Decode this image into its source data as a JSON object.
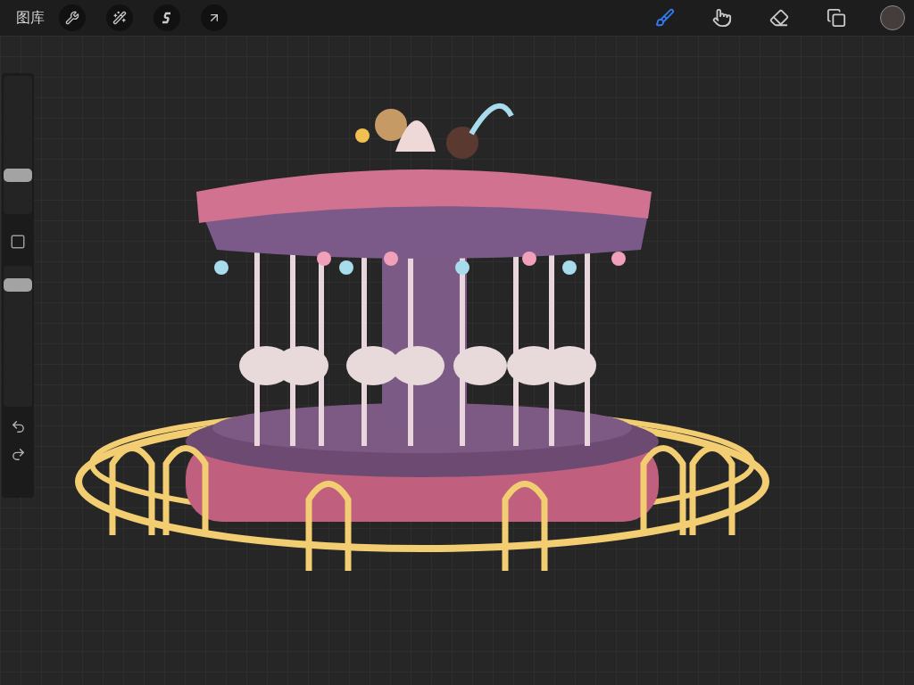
{
  "toolbar": {
    "gallery": "图库",
    "left_tools": [
      {
        "kind": "adjust"
      },
      {
        "kind": "wand"
      },
      {
        "kind": "select"
      },
      {
        "kind": "transform"
      }
    ],
    "right_tools": [
      {
        "kind": "brush",
        "selected": true
      },
      {
        "kind": "smudge",
        "selected": false
      },
      {
        "kind": "eraser",
        "selected": false
      },
      {
        "kind": "layers",
        "selected": false
      }
    ],
    "color": {
      "color": "#453c3c"
    }
  },
  "sidebar": {
    "size_slider": {
      "level": 0.26
    },
    "opacity_slider": {
      "level": 0.9
    }
  }
}
